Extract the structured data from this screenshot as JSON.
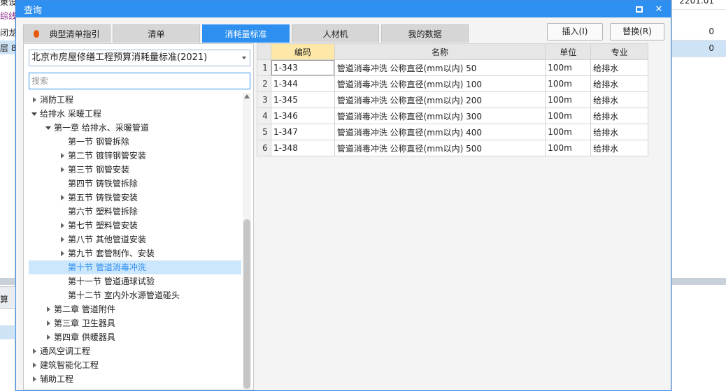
{
  "background": {
    "left_fragments": [
      "東设",
      "综线",
      "闭龙",
      "层 8",
      "算"
    ],
    "right_values": [
      "2201.01",
      "0",
      "0"
    ]
  },
  "dialog": {
    "title": "查询",
    "tabs": [
      {
        "label": "典型清单指引",
        "active": false,
        "flame": true
      },
      {
        "label": "清单",
        "active": false
      },
      {
        "label": "消耗量标准",
        "active": true
      },
      {
        "label": "人材机",
        "active": false
      },
      {
        "label": "我的数据",
        "active": false
      }
    ],
    "buttons": {
      "insert": "插入(I)",
      "replace": "替换(R)"
    },
    "standard_select": "北京市房屋修缮工程预算消耗量标准(2021)",
    "search_placeholder": "搜索",
    "tree": [
      {
        "label": "消防工程",
        "level": 0,
        "state": "collapsed"
      },
      {
        "label": "给排水 采暖工程",
        "level": 0,
        "state": "expanded"
      },
      {
        "label": "第一章 给排水、采暖管道",
        "level": 1,
        "state": "expanded"
      },
      {
        "label": "第一节 钢管拆除",
        "level": 2,
        "state": "leaf"
      },
      {
        "label": "第二节 镀锌钢管安装",
        "level": 2,
        "state": "collapsed"
      },
      {
        "label": "第三节 钢管安装",
        "level": 2,
        "state": "collapsed"
      },
      {
        "label": "第四节 铸铁管拆除",
        "level": 2,
        "state": "leaf"
      },
      {
        "label": "第五节 铸铁管安装",
        "level": 2,
        "state": "collapsed"
      },
      {
        "label": "第六节 塑料管拆除",
        "level": 2,
        "state": "leaf"
      },
      {
        "label": "第七节 塑料管安装",
        "level": 2,
        "state": "collapsed"
      },
      {
        "label": "第八节 其他管道安装",
        "level": 2,
        "state": "collapsed"
      },
      {
        "label": "第九节 套管制作、安装",
        "level": 2,
        "state": "collapsed"
      },
      {
        "label": "第十节 管道消毒冲洗",
        "level": 2,
        "state": "leaf",
        "selected": true
      },
      {
        "label": "第十一节 管道通球试验",
        "level": 2,
        "state": "leaf"
      },
      {
        "label": "第十二节 室内外水源管道碰头",
        "level": 2,
        "state": "leaf"
      },
      {
        "label": "第二章 管道附件",
        "level": 1,
        "state": "collapsed"
      },
      {
        "label": "第三章 卫生器具",
        "level": 1,
        "state": "collapsed"
      },
      {
        "label": "第四章 供暖器具",
        "level": 1,
        "state": "collapsed"
      },
      {
        "label": "通风空调工程",
        "level": 0,
        "state": "collapsed"
      },
      {
        "label": "建筑智能化工程",
        "level": 0,
        "state": "collapsed"
      },
      {
        "label": "辅助工程",
        "level": 0,
        "state": "collapsed"
      }
    ],
    "grid": {
      "headers": [
        "编码",
        "名称",
        "单位",
        "专业"
      ],
      "rows": [
        {
          "idx": "1",
          "code": "1-343",
          "name": "管道消毒冲洗 公称直径(mm以内) 50",
          "unit": "100m",
          "major": "给排水"
        },
        {
          "idx": "2",
          "code": "1-344",
          "name": "管道消毒冲洗 公称直径(mm以内) 100",
          "unit": "100m",
          "major": "给排水"
        },
        {
          "idx": "3",
          "code": "1-345",
          "name": "管道消毒冲洗 公称直径(mm以内) 200",
          "unit": "100m",
          "major": "给排水"
        },
        {
          "idx": "4",
          "code": "1-346",
          "name": "管道消毒冲洗 公称直径(mm以内) 300",
          "unit": "100m",
          "major": "给排水"
        },
        {
          "idx": "5",
          "code": "1-347",
          "name": "管道消毒冲洗 公称直径(mm以内) 400",
          "unit": "100m",
          "major": "给排水"
        },
        {
          "idx": "6",
          "code": "1-348",
          "name": "管道消毒冲洗 公称直径(mm以内) 500",
          "unit": "100m",
          "major": "给排水"
        }
      ]
    }
  }
}
